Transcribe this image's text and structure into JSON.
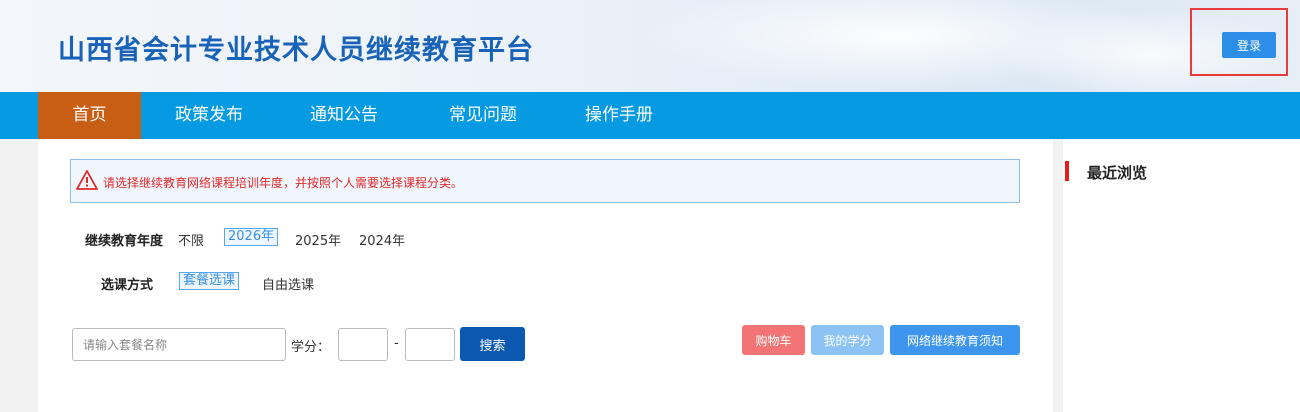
{
  "header": {
    "title": "山西省会计专业技术人员继续教育平台",
    "login_label": "登录"
  },
  "nav": {
    "items": [
      {
        "label": "首页",
        "active": true
      },
      {
        "label": "政策发布",
        "active": false
      },
      {
        "label": "通知公告",
        "active": false
      },
      {
        "label": "常见问题",
        "active": false
      },
      {
        "label": "操作手册",
        "active": false
      }
    ]
  },
  "notice": {
    "icon": "warning-icon",
    "text": "请选择继续教育网络课程培训年度，并按照个人需要选择课程分类。"
  },
  "filters": {
    "year_label": "继续教育年度",
    "years": [
      "不限",
      "2026年",
      "2025年",
      "2024年"
    ],
    "selected_year": "2026年",
    "mode_label": "选课方式",
    "modes": [
      "套餐选课",
      "自由选课"
    ],
    "selected_mode": "套餐选课"
  },
  "search": {
    "placeholder": "请输入套餐名称",
    "value": "",
    "credit_label": "学分：",
    "credit_min": "",
    "credit_max": "",
    "range_separator": "-",
    "button_label": "搜索"
  },
  "actions": {
    "cart_label": "购物车",
    "my_credits_label": "我的学分",
    "notice_label": "网络继续教育须知"
  },
  "sidebar": {
    "title": "最近浏览"
  },
  "colors": {
    "nav_bg": "#069ae3",
    "nav_active": "#c85e14",
    "title_blue": "#1862b8",
    "cart_btn": "#f27474",
    "credits_btn": "#8cc3f4",
    "notice_btn": "#3d95ee",
    "search_btn": "#0b58b0",
    "alert_red": "#e02a2a"
  }
}
